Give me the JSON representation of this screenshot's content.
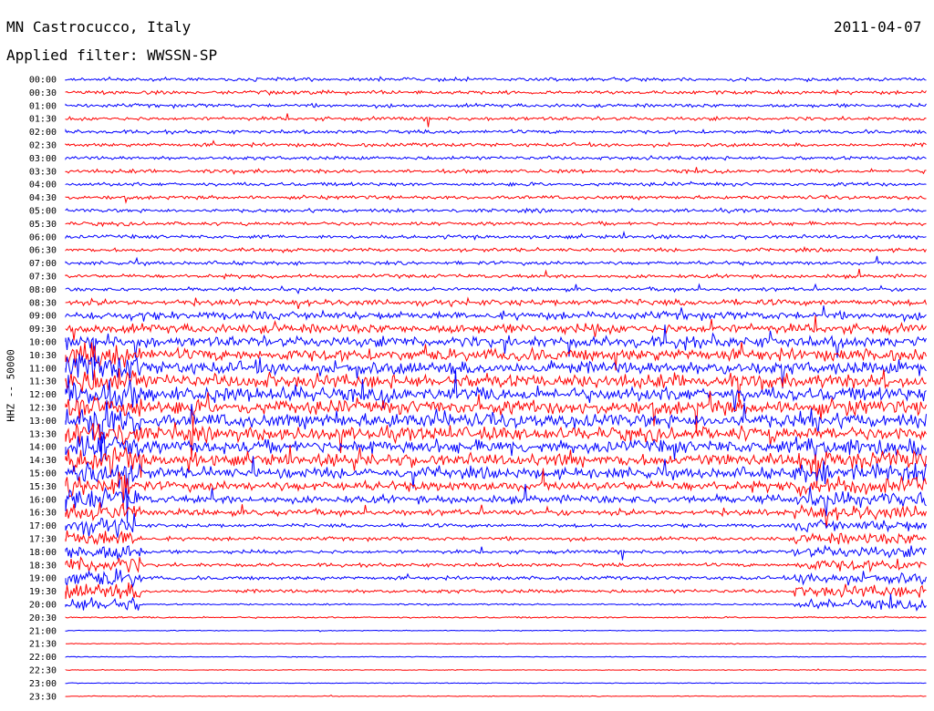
{
  "header": {
    "station": "MN Castrocucco, Italy",
    "date": "2011-04-07",
    "filter": "Applied filter: WWSSN-SP"
  },
  "chart_data": {
    "type": "line",
    "title": "MN Castrocucco, Italy",
    "subtitle": "Applied filter: WWSSN-SP",
    "date": "2011-04-07",
    "ylabel": "HHZ -- 50000",
    "xlabel": "",
    "y_tick_labels": [
      "00:00",
      "00:30",
      "01:00",
      "01:30",
      "02:00",
      "02:30",
      "03:00",
      "03:30",
      "04:00",
      "04:30",
      "05:00",
      "05:30",
      "06:00",
      "06:30",
      "07:00",
      "07:30",
      "08:00",
      "08:30",
      "09:00",
      "09:30",
      "10:00",
      "10:30",
      "11:00",
      "11:30",
      "12:00",
      "12:30",
      "13:00",
      "13:30",
      "14:00",
      "14:30",
      "15:00",
      "15:30",
      "16:00",
      "16:30",
      "17:00",
      "17:30",
      "18:00",
      "18:30",
      "19:00",
      "19:30",
      "20:00",
      "20:30",
      "21:00",
      "21:30",
      "22:00",
      "22:30",
      "23:00",
      "23:30"
    ],
    "row_colors": [
      "#0000ff",
      "#ff0000"
    ],
    "grid": false,
    "legend": "none"
  }
}
